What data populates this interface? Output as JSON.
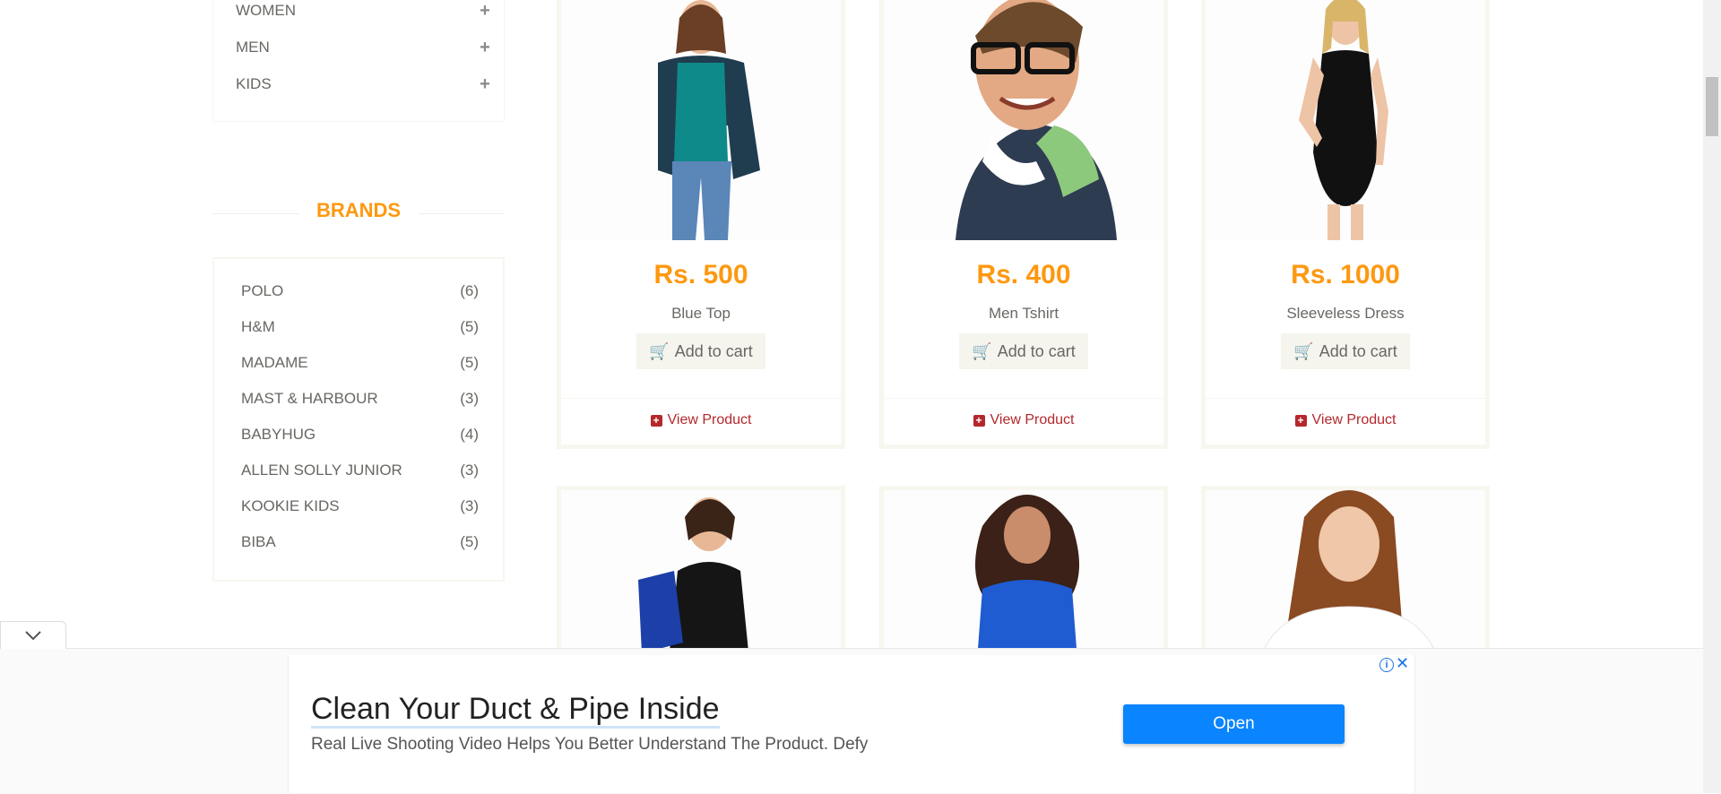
{
  "categories": [
    {
      "label": "WOMEN"
    },
    {
      "label": "MEN"
    },
    {
      "label": "KIDS"
    }
  ],
  "brands": {
    "title": "BRANDS",
    "items": [
      {
        "name": "POLO",
        "count": "(6)"
      },
      {
        "name": "H&M",
        "count": "(5)"
      },
      {
        "name": "MADAME",
        "count": "(5)"
      },
      {
        "name": "MAST & HARBOUR",
        "count": "(3)"
      },
      {
        "name": "BABYHUG",
        "count": "(4)"
      },
      {
        "name": "ALLEN SOLLY JUNIOR",
        "count": "(3)"
      },
      {
        "name": "KOOKIE KIDS",
        "count": "(3)"
      },
      {
        "name": "BIBA",
        "count": "(5)"
      }
    ]
  },
  "products": [
    {
      "price": "Rs. 500",
      "name": "Blue Top",
      "add_label": "Add to cart",
      "view_label": "View Product"
    },
    {
      "price": "Rs. 400",
      "name": "Men Tshirt",
      "add_label": "Add to cart",
      "view_label": "View Product"
    },
    {
      "price": "Rs. 1000",
      "name": "Sleeveless Dress",
      "add_label": "Add to cart",
      "view_label": "View Product"
    }
  ],
  "ad": {
    "title": "Clean Your Duct & Pipe Inside",
    "subtitle": "Real Live Shooting Video Helps You Better Understand The Product. Defy",
    "button_label": "Open"
  },
  "colors": {
    "accent": "#fe980f",
    "link": "#b4282c",
    "ad_button": "#0a84ff"
  }
}
